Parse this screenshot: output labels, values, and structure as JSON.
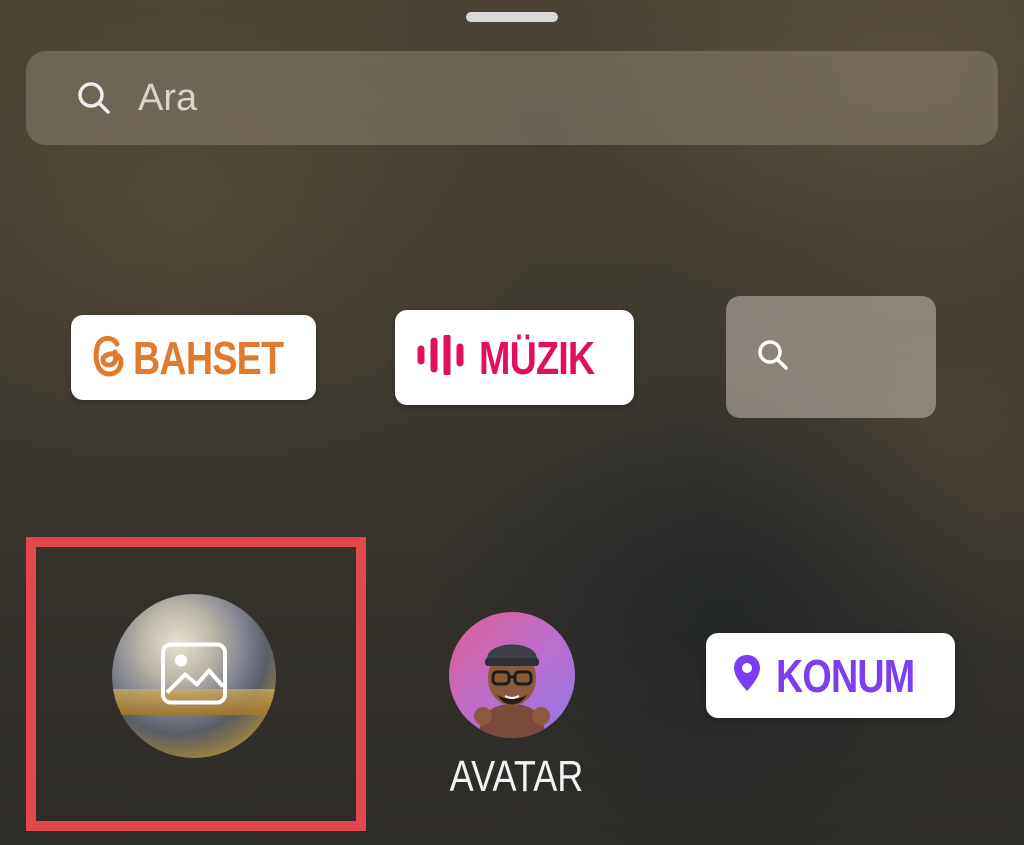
{
  "search": {
    "placeholder": "Ara",
    "icon": "search-icon"
  },
  "stickers": {
    "bahset": {
      "label": "BAHSET",
      "icon": "threads-icon",
      "color": "#e07a2e"
    },
    "muzik": {
      "label": "MÜZIK",
      "icon": "soundwave-icon",
      "color": "#e0105e"
    },
    "sticker_search": {
      "icon": "search-icon"
    },
    "photo": {
      "icon": "gallery-icon"
    },
    "avatar": {
      "label": "AVATAR"
    },
    "konum": {
      "label": "KONUM",
      "icon": "location-pin-icon",
      "color": "#7b3ff0"
    }
  },
  "highlight_color": "#e0484d"
}
